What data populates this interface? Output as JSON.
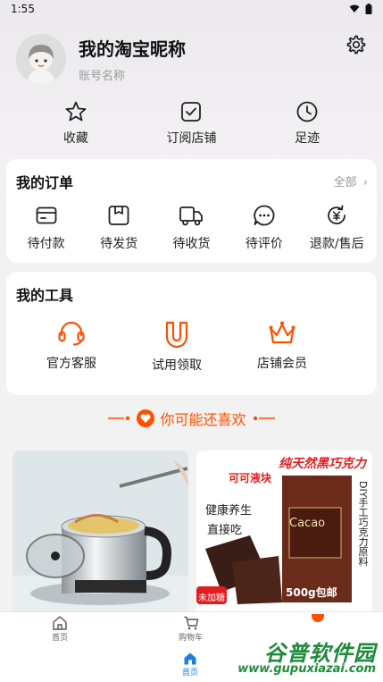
{
  "status_bar": {
    "time": "1:55"
  },
  "profile": {
    "nickname": "我的淘宝昵称",
    "account": "账号名称"
  },
  "quick_links": [
    {
      "label": "收藏",
      "icon": "star-icon"
    },
    {
      "label": "订阅店铺",
      "icon": "check-square-icon"
    },
    {
      "label": "足迹",
      "icon": "clock-icon"
    }
  ],
  "orders": {
    "title": "我的订单",
    "more": "全部",
    "items": [
      {
        "label": "待付款",
        "icon": "wallet-icon"
      },
      {
        "label": "待发货",
        "icon": "box-icon"
      },
      {
        "label": "待收货",
        "icon": "truck-icon"
      },
      {
        "label": "待评价",
        "icon": "comment-icon"
      },
      {
        "label": "退款/售后",
        "icon": "refund-icon"
      }
    ]
  },
  "tools": {
    "title": "我的工具",
    "items": [
      {
        "label": "官方客服",
        "icon": "headset-icon"
      },
      {
        "label": "试用领取",
        "icon": "magnet-icon"
      },
      {
        "label": "店铺会员",
        "icon": "crown-icon"
      }
    ]
  },
  "recommend": {
    "label": "你可能还喜欢"
  },
  "products": {
    "product_2": {
      "banner": "纯天然黑巧克力",
      "tag": "可可液块",
      "text1": "健康养生",
      "text2": "直接吃",
      "vertical": "DIY手工巧克力原料",
      "brand": "Cacao",
      "weight": "500g包邮",
      "badge": "未加糖"
    }
  },
  "bottom_nav": {
    "home": "首页",
    "cart": "购物车",
    "home_active": "首页"
  },
  "watermark": {
    "name": "谷普软件园",
    "url": "www.gupuxiazai.com"
  },
  "colors": {
    "accent": "#ff5000",
    "text": "#111111",
    "muted": "#999999"
  }
}
